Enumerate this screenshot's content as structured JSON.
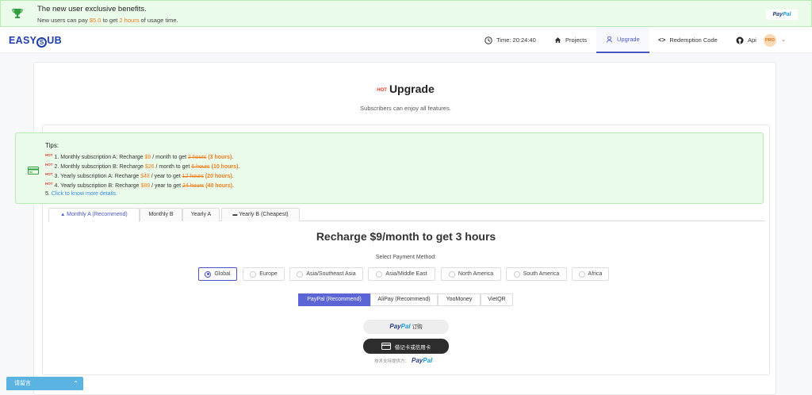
{
  "banner": {
    "title": "The new user exclusive benefits.",
    "sub_pre": "New users can pay ",
    "sub_price": "$5.0",
    "sub_mid": " to get ",
    "sub_hours": "2 hours",
    "sub_post": " of usage time.",
    "badge_pay": "Pay",
    "badge_pal": "Pal"
  },
  "nav": {
    "logo_pre": "EASY",
    "logo_s": "S",
    "logo_post": "UB",
    "time": "Time: 20:24:40",
    "projects": "Projects",
    "upgrade": "Upgrade",
    "redemption": "Redemption Code",
    "api": "Api",
    "avatar": "PRO"
  },
  "page": {
    "hot": "HOT",
    "title": "Upgrade",
    "subtitle": "Subscribers can enjoy all features."
  },
  "tips": {
    "heading": "Tips:",
    "hot": "HOT",
    "lines": [
      {
        "pre": "1. Monthly subscription A: Recharge ",
        "price": "$9",
        "mid": " / month to get ",
        "old": "2 hours",
        "new": "3 hours"
      },
      {
        "pre": "2. Monthly subscription B: Recharge ",
        "price": "$26",
        "mid": " / month to get ",
        "old": "6 hours",
        "new": "10 hours"
      },
      {
        "pre": "3. Yearly subscription A: Recharge ",
        "price": "$48",
        "mid": " / year to get ",
        "old": "12 hours",
        "new": "20 hours"
      },
      {
        "pre": "4. Yearly subscription B: Recharge ",
        "price": "$89",
        "mid": " / year to get ",
        "old": "24 hours",
        "new": "40 hours"
      }
    ],
    "line5_pre": "5. ",
    "line5_link": "Click to know more details."
  },
  "plan_tabs": [
    "Monthly A (Recommend)",
    "Monthly B",
    "Yearly A",
    "Yearly B (Cheapest)"
  ],
  "recharge_title": "Recharge $9/month to get 3 hours",
  "payment": {
    "label": "Select Payment Method:",
    "regions": [
      "Global",
      "Europe",
      "Asia/Southeast Asia",
      "Asia/Middle East",
      "North America",
      "South America",
      "Africa"
    ],
    "selected_region": "Global",
    "methods": [
      "PayPal (Recommend)",
      "AliPay (Recommend)",
      "YooMoney",
      "VietQR"
    ],
    "selected_method": "PayPal (Recommend)"
  },
  "paypal_button": {
    "pay": "Pay",
    "pal": "Pal",
    "cn": "订购"
  },
  "card_button": "借记卡或信用卡",
  "powered": {
    "text": "技术支持提供方：",
    "pay": "Pay",
    "pal": "Pal"
  },
  "chat": {
    "label": "请留言"
  },
  "colors": {
    "accent": "#4a55c8",
    "highlight": "#f07b1d",
    "tips_bg": "#eafbe9",
    "hot": "#e63b2e"
  }
}
